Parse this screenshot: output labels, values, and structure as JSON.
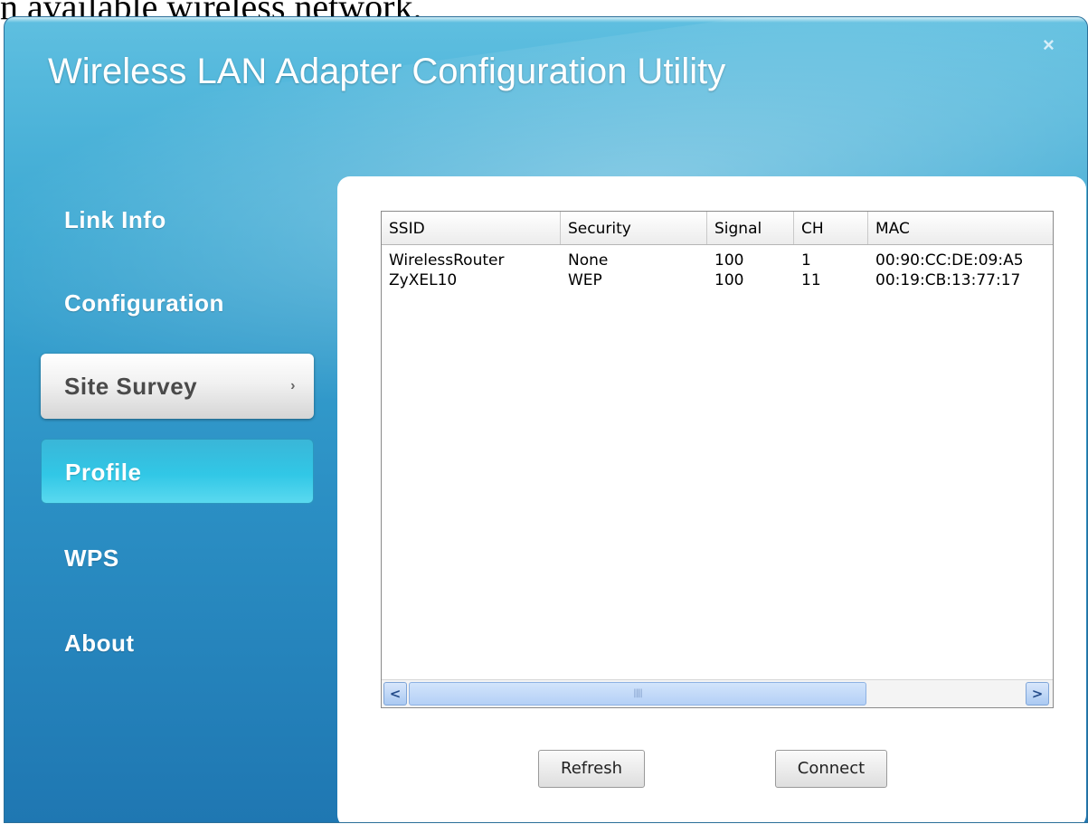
{
  "document": {
    "caption_fragment": "n available wireless network."
  },
  "window": {
    "title": "Wireless LAN Adapter Configuration Utility",
    "close_glyph": "×"
  },
  "sidebar": {
    "items": [
      {
        "label": "Link Info",
        "state": "normal"
      },
      {
        "label": "Configuration",
        "state": "normal"
      },
      {
        "label": "Site Survey",
        "state": "selected"
      },
      {
        "label": "Profile",
        "state": "hover"
      },
      {
        "label": "WPS",
        "state": "normal"
      },
      {
        "label": "About",
        "state": "normal"
      }
    ],
    "selected_chevron": "›"
  },
  "site_survey": {
    "columns": [
      "SSID",
      "Security",
      "Signal",
      "CH",
      "MAC"
    ],
    "rows": [
      [
        "WirelessRouter",
        "None",
        "100",
        "1",
        "00:90:CC:DE:09:A5"
      ],
      [
        "ZyXEL10",
        "WEP",
        "100",
        "11",
        "00:19:CB:13:77:17"
      ]
    ],
    "scroll_left": "<",
    "scroll_right": ">",
    "scroll_grip": "||||"
  },
  "buttons": {
    "refresh": "Refresh",
    "connect": "Connect"
  },
  "colors": {
    "window_gradient_top": "#5fbfe0",
    "window_gradient_bottom": "#1f77b2",
    "selected_nav": "#f1f1f1",
    "hover_nav": "#31c7e6"
  }
}
